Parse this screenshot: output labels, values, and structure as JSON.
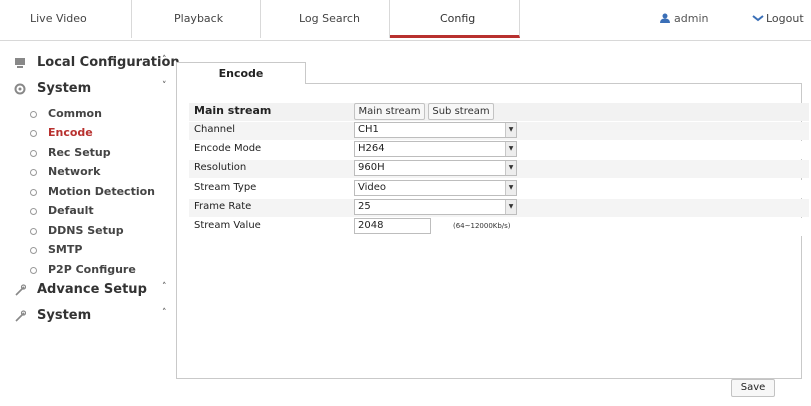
{
  "nav": {
    "tabs": [
      {
        "label": "Live Video"
      },
      {
        "label": "Playback"
      },
      {
        "label": "Log Search"
      },
      {
        "label": "Config"
      }
    ],
    "user": "admin",
    "logout": "Logout",
    "accent": "#b8312f"
  },
  "sidebar": {
    "local": "Local Configuration",
    "system": "System",
    "items": [
      "Common",
      "Encode",
      "Rec Setup",
      "Network",
      "Motion Detection",
      "Default",
      "DDNS Setup",
      "SMTP",
      "P2P Configure"
    ],
    "advance": "Advance Setup",
    "system2": "System"
  },
  "content": {
    "tab": "Encode",
    "heading": "Main stream",
    "buttons": {
      "main": "Main stream",
      "sub": "Sub stream"
    },
    "fields": [
      {
        "label": "Channel",
        "value": "CH1"
      },
      {
        "label": "Encode Mode",
        "value": "H264"
      },
      {
        "label": "Resolution",
        "value": "960H"
      },
      {
        "label": "Stream Type",
        "value": "Video"
      },
      {
        "label": "Frame Rate",
        "value": "25"
      }
    ],
    "stream_value": {
      "label": "Stream Value",
      "value": "2048",
      "hint": "(64~12000Kb/s)"
    },
    "save": "Save"
  }
}
